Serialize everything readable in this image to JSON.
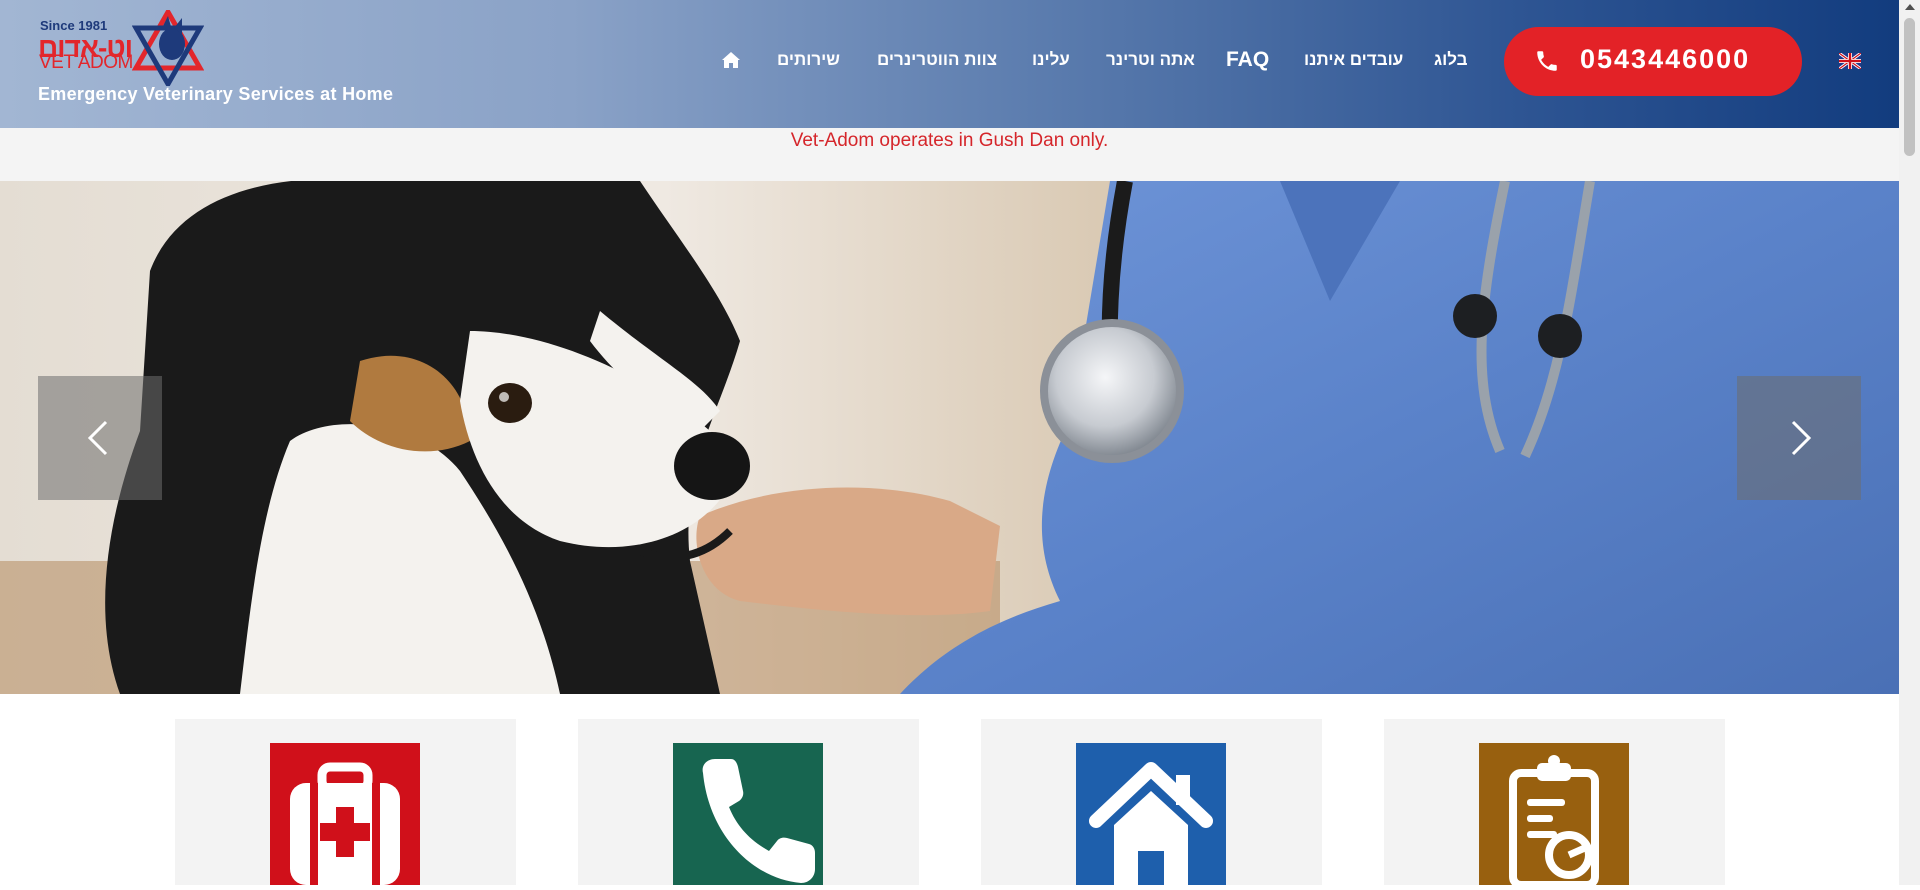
{
  "logo": {
    "since": "Since 1981",
    "name_he": "וט-אדום",
    "name_en": "VET ADOM",
    "tagline": "Emergency Veterinary Services at Home"
  },
  "nav": {
    "items": [
      {
        "label": "שירותים"
      },
      {
        "label": "צוות הווטרינרים"
      },
      {
        "label": "עלינו"
      },
      {
        "label": "אתה וטרינר"
      },
      {
        "label": "FAQ"
      },
      {
        "label": "עובדים איתנו"
      },
      {
        "label": "בלוג"
      }
    ],
    "home_icon": "home-icon"
  },
  "phone": {
    "number": "0543446000",
    "icon": "phone-icon"
  },
  "language": {
    "icon": "uk-flag-icon"
  },
  "notice": {
    "text": "Vet-Adom operates in Gush Dan only."
  },
  "hero": {
    "prev_icon": "chevron-left-icon",
    "next_icon": "chevron-right-icon"
  },
  "features": [
    {
      "icon": "medical-kit-icon",
      "color": "#d0101a"
    },
    {
      "icon": "phone-icon",
      "color": "#176550"
    },
    {
      "icon": "house-icon",
      "color": "#1e5fac"
    },
    {
      "icon": "clipboard-icon",
      "color": "#98600f"
    }
  ],
  "colors": {
    "accent_red": "#e32227",
    "header_dark": "#123c7e",
    "notice_text": "#d5262b"
  }
}
